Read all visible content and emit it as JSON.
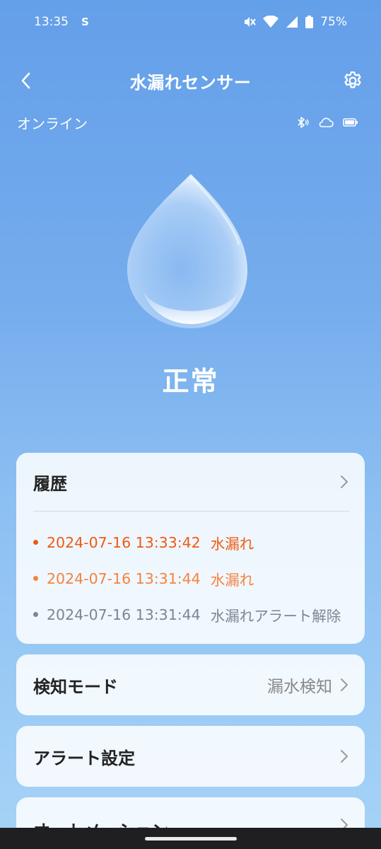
{
  "status_bar": {
    "time": "13:35",
    "app_icon": "S",
    "battery": "75%"
  },
  "header": {
    "title": "水漏れセンサー"
  },
  "connection": {
    "status": "オンライン"
  },
  "sensor": {
    "state": "正常"
  },
  "history": {
    "label": "履歴",
    "items": [
      {
        "time": "2024-07-16 13:33:42",
        "event": "水漏れ",
        "color": "#f05a14"
      },
      {
        "time": "2024-07-16 13:31:44",
        "event": "水漏れ",
        "color": "#f5833f"
      },
      {
        "time": "2024-07-16 13:31:44",
        "event": "水漏れアラート解除",
        "color": "#7f8590"
      }
    ]
  },
  "detection_mode": {
    "label": "検知モード",
    "value": "漏水検知"
  },
  "alert_settings": {
    "label": "アラート設定"
  },
  "automation": {
    "label": "オートメーション"
  },
  "colors": {
    "accent_orange": "#f05a14",
    "background_top": "#649fe9",
    "background_bottom": "#a6d3f7"
  }
}
